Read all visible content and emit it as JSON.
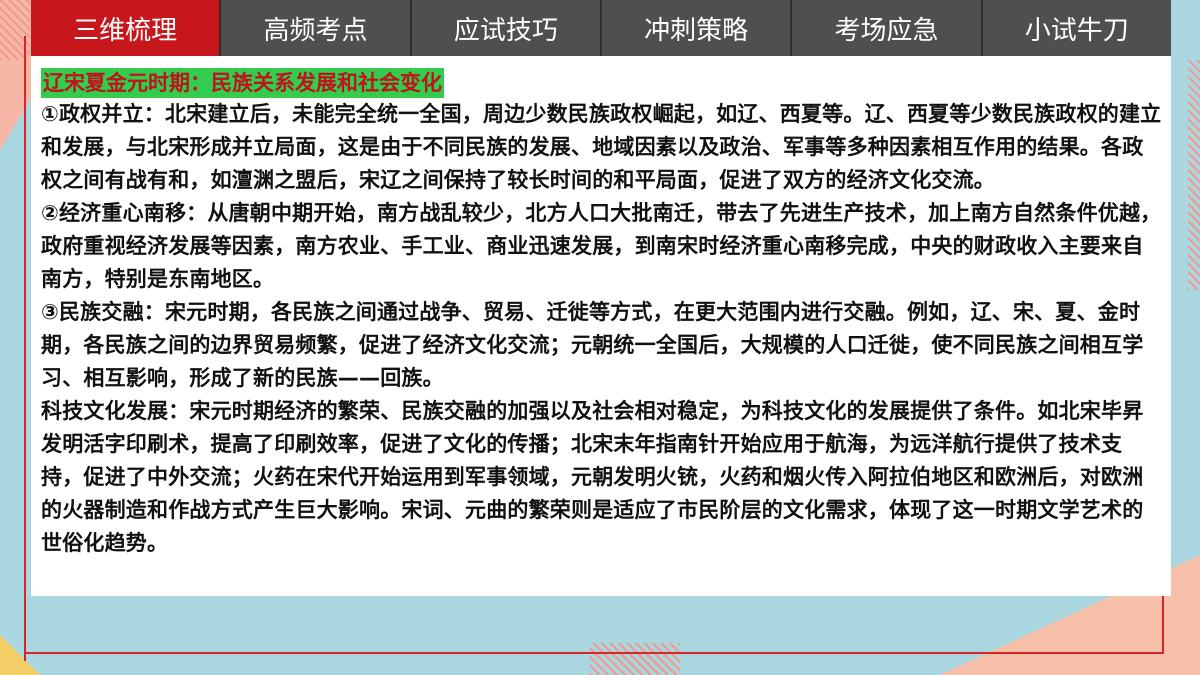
{
  "tabs": [
    {
      "label": "三维梳理",
      "active": true
    },
    {
      "label": "高频考点",
      "active": false
    },
    {
      "label": "应试技巧",
      "active": false
    },
    {
      "label": "冲刺策略",
      "active": false
    },
    {
      "label": "考场应急",
      "active": false
    },
    {
      "label": "小试牛刀",
      "active": false
    }
  ],
  "content": {
    "heading": "辽宋夏金元时期：民族关系发展和社会变化",
    "paragraphs": [
      "①政权并立：北宋建立后，未能完全统一全国，周边少数民族政权崛起，如辽、西夏等。辽、西夏等少数民族政权的建立和发展，与北宋形成并立局面，这是由于不同民族的发展、地域因素以及政治、军事等多种因素相互作用的结果。各政权之间有战有和，如澶渊之盟后，宋辽之间保持了较长时间的和平局面，促进了双方的经济文化交流。",
      "②经济重心南移：从唐朝中期开始，南方战乱较少，北方人口大批南迁，带去了先进生产技术，加上南方自然条件优越，政府重视经济发展等因素，南方农业、手工业、商业迅速发展，到南宋时经济重心南移完成，中央的财政收入主要来自南方，特别是东南地区。",
      "③民族交融：宋元时期，各民族之间通过战争、贸易、迁徙等方式，在更大范围内进行交融。例如，辽、宋、夏、金时期，各民族之间的边界贸易频繁，促进了经济文化交流；元朝统一全国后，大规模的人口迁徙，使不同民族之间相互学习、相互影响，形成了新的民族——回族。",
      "科技文化发展：宋元时期经济的繁荣、民族交融的加强以及社会相对稳定，为科技文化的发展提供了条件。如北宋毕昇发明活字印刷术，提高了印刷效率，促进了文化的传播；北宋末年指南针开始应用于航海，为远洋航行提供了技术支持，促进了中外交流；火药在宋代开始运用到军事领域，元朝发明火铳，火药和烟火传入阿拉伯地区和欧洲后，对欧洲的火器制造和作战方式产生巨大影响。宋词、元曲的繁荣则是适应了市民阶层的文化需求，体现了这一时期文学艺术的世俗化趋势。"
    ]
  },
  "colors": {
    "active_tab": "#c8161d",
    "inactive_tab": "#4f4f4f",
    "heading_bg": "#33cc4e",
    "heading_text": "#c0121a",
    "frame": "#d9242b",
    "background": "#a9d6df"
  }
}
